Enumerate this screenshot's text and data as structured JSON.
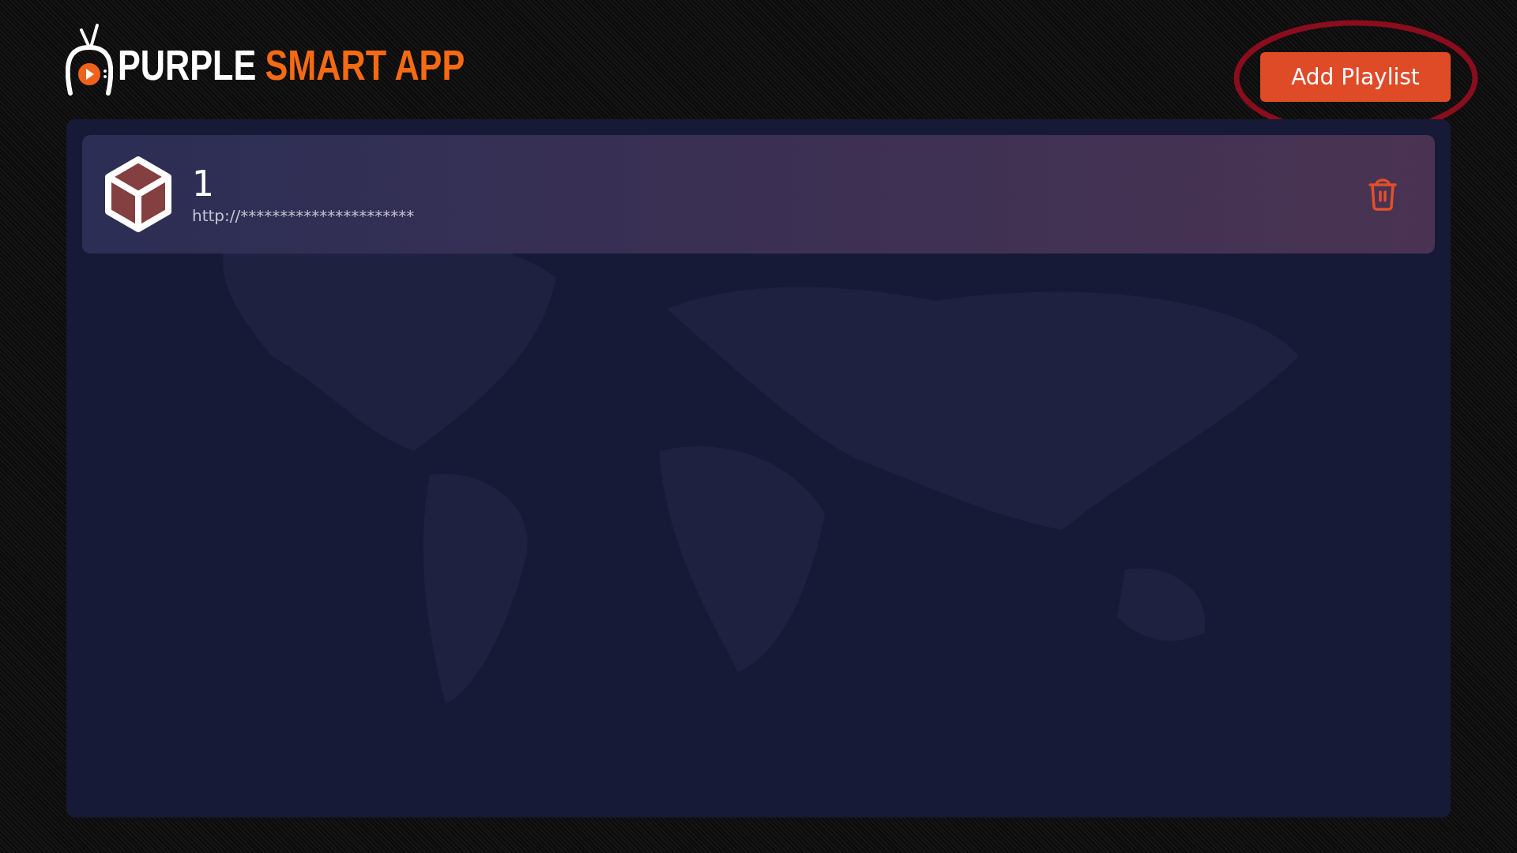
{
  "header": {
    "logo": [
      {
        "text": "PURPLE",
        "kind": "plain"
      },
      {
        "text": "SMART APP",
        "kind": "accent"
      }
    ],
    "add_button": {
      "label": "Add Playlist",
      "highlighted": true
    }
  },
  "playlists": [
    {
      "name": "1",
      "url": "http://**********************"
    }
  ]
}
